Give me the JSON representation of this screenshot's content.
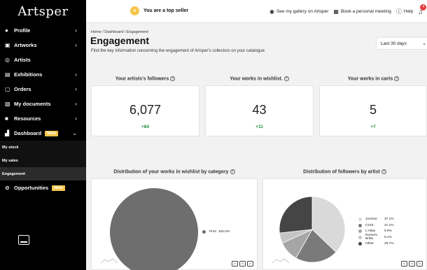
{
  "app": {
    "logo": "Artsper"
  },
  "topbar": {
    "seller_text": "You are a top seller",
    "links": [
      {
        "icon": "globe-icon",
        "label": "See my gallery on Artsper"
      },
      {
        "icon": "calendar-icon",
        "label": "Book a personal meeting"
      },
      {
        "icon": "help-icon",
        "label": "Help"
      }
    ],
    "notification_count": "4"
  },
  "sidebar": {
    "items": [
      {
        "label": "Profile",
        "icon": "user-icon"
      },
      {
        "label": "Artworks",
        "icon": "image-icon"
      },
      {
        "label": "Artists",
        "icon": "artist-icon"
      },
      {
        "label": "Exhibitions",
        "icon": "gallery-icon"
      },
      {
        "label": "Orders",
        "icon": "orders-icon"
      },
      {
        "label": "My documents",
        "icon": "documents-icon"
      },
      {
        "label": "Resources",
        "icon": "resources-icon"
      },
      {
        "label": "Dashboard",
        "icon": "dashboard-icon",
        "badge": "New"
      }
    ],
    "sub_items": [
      "My stock",
      "My sales",
      "Engagement"
    ],
    "opportunities": {
      "label": "Opportunities",
      "badge": "New"
    }
  },
  "page": {
    "breadcrumb": "Home / Dashboard / Engagement",
    "title": "Engagement",
    "subtitle": "Find the key information concerning the engagement of Artsper's collectors on your catalogue",
    "period": "Last 30 days"
  },
  "stats": [
    {
      "label": "Your artists's followers",
      "value": "6,077",
      "delta": "+84"
    },
    {
      "label": "Your works in wishlist.",
      "value": "43",
      "delta": "+11"
    },
    {
      "label": "Your works in carts",
      "value": "5",
      "delta": "+7"
    }
  ],
  "charts": {
    "wishlist_title": "Distribution of your works in wishlist by category",
    "followers_title": "Distribution of followers by artist"
  },
  "chart_data": [
    {
      "type": "pie",
      "title": "Distribution of your works in wishlist by category",
      "categories": [
        "Print"
      ],
      "values": [
        100.0
      ],
      "labels": [
        "100.0%"
      ],
      "colors": [
        "#6e6e6e"
      ]
    },
    {
      "type": "pie",
      "title": "Distribution of followers by artist",
      "categories": [
        "JonOne",
        "C215",
        "L'Atlas",
        "Romero Britto",
        "Other"
      ],
      "values": [
        37.1,
        21.1,
        9.9,
        5.1,
        26.7
      ],
      "labels": [
        "37.1%",
        "21.1%",
        "9.9%",
        "5.1%",
        "26.7%"
      ],
      "colors": [
        "#d9d9d9",
        "#7a7a7a",
        "#a6a6a6",
        "#c4c4c4",
        "#454545"
      ]
    }
  ]
}
